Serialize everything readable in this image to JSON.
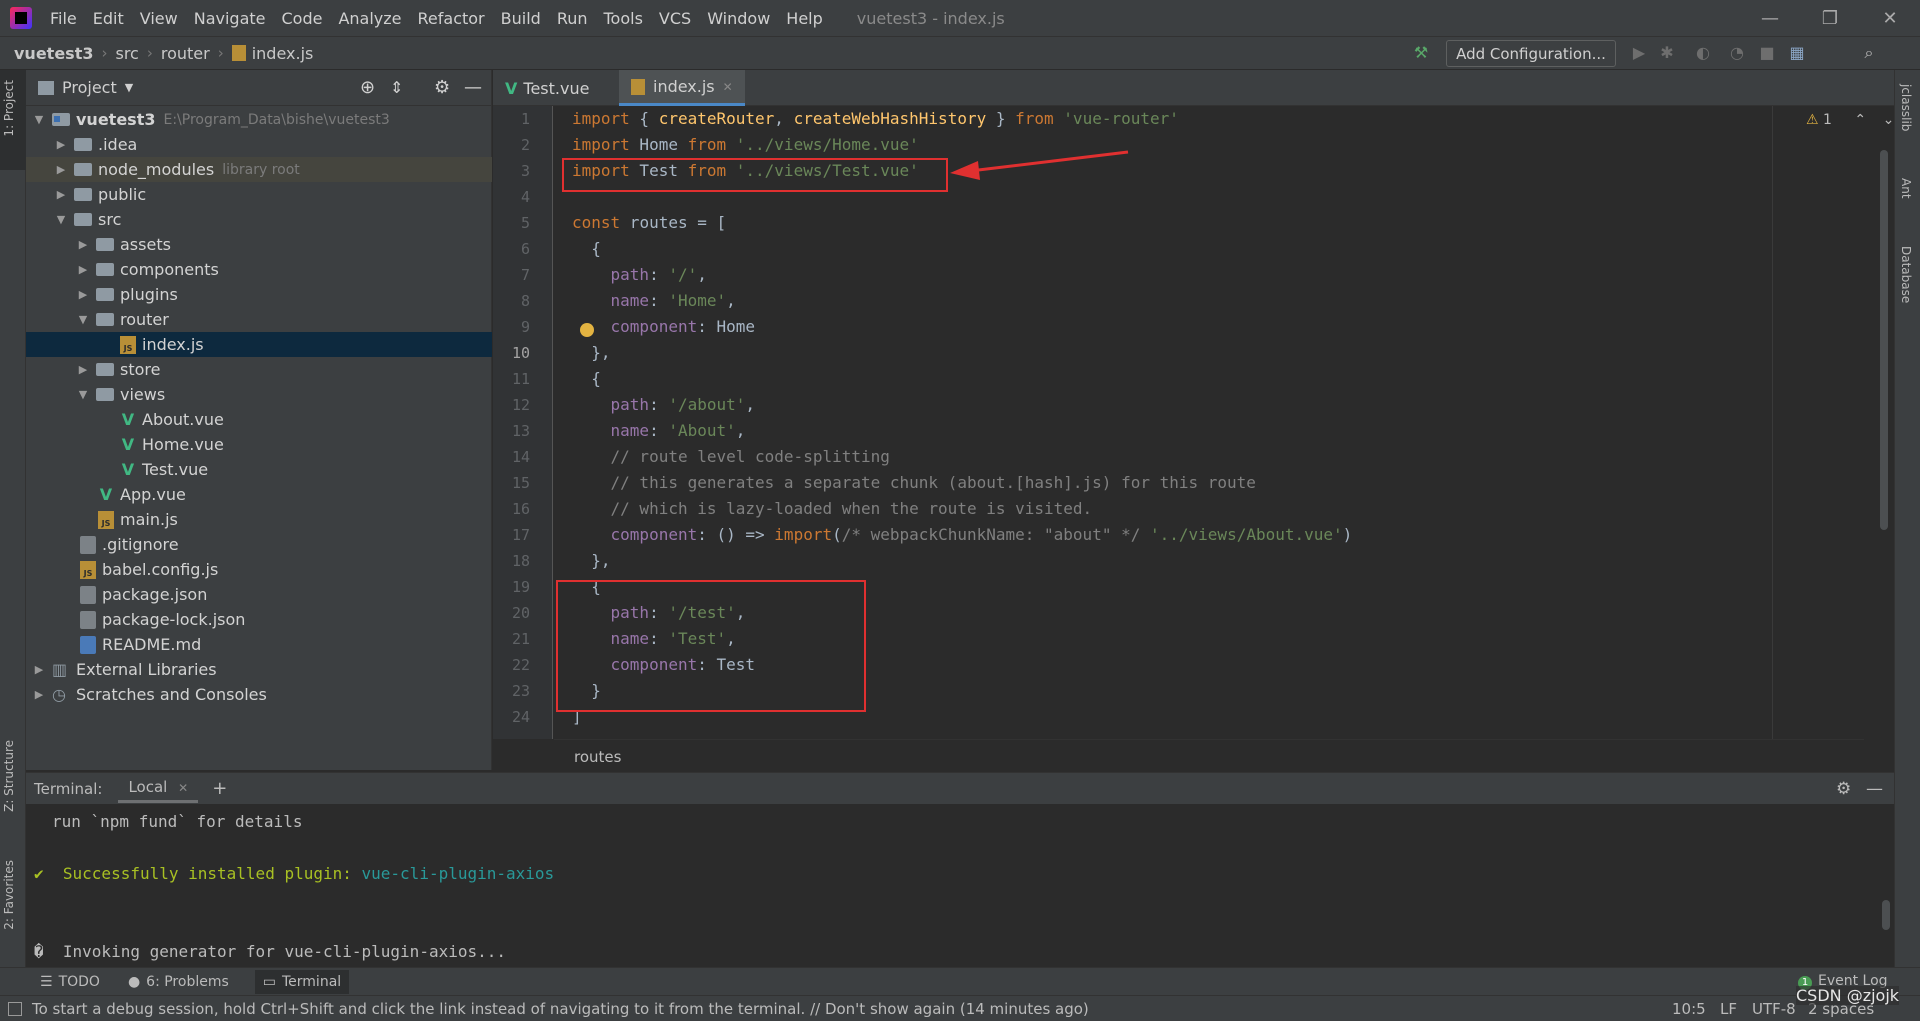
{
  "title_bar": {
    "menu": [
      "File",
      "Edit",
      "View",
      "Navigate",
      "Code",
      "Analyze",
      "Refactor",
      "Build",
      "Run",
      "Tools",
      "VCS",
      "Window",
      "Help"
    ],
    "window_title": "vuetest3 - index.js"
  },
  "nav_bar": {
    "crumbs": [
      "vuetest3",
      "src",
      "router",
      "index.js"
    ],
    "add_configuration": "Add Configuration..."
  },
  "left_stripe": {
    "project": "1: Project",
    "structure": "Z: Structure",
    "favorites": "2: Favorites"
  },
  "right_stripe": {
    "jclasslib": "jclasslib",
    "ant": "Ant",
    "database": "Database"
  },
  "project_panel": {
    "header": "Project",
    "tree": [
      {
        "label": "vuetest3",
        "extra": "E:\\Program_Data\\bishe\\vuetest3",
        "type": "project"
      },
      {
        "label": ".idea",
        "type": "folder"
      },
      {
        "label": "node_modules",
        "extra": "library root",
        "type": "folder"
      },
      {
        "label": "public",
        "type": "folder"
      },
      {
        "label": "src",
        "type": "folder"
      },
      {
        "label": "assets",
        "type": "folder"
      },
      {
        "label": "components",
        "type": "folder"
      },
      {
        "label": "plugins",
        "type": "folder"
      },
      {
        "label": "router",
        "type": "folder"
      },
      {
        "label": "index.js",
        "type": "js"
      },
      {
        "label": "store",
        "type": "folder"
      },
      {
        "label": "views",
        "type": "folder"
      },
      {
        "label": "About.vue",
        "type": "vue"
      },
      {
        "label": "Home.vue",
        "type": "vue"
      },
      {
        "label": "Test.vue",
        "type": "vue"
      },
      {
        "label": "App.vue",
        "type": "vue"
      },
      {
        "label": "main.js",
        "type": "js"
      },
      {
        "label": ".gitignore",
        "type": "cfg"
      },
      {
        "label": "babel.config.js",
        "type": "js"
      },
      {
        "label": "package.json",
        "type": "cfg"
      },
      {
        "label": "package-lock.json",
        "type": "cfg"
      },
      {
        "label": "README.md",
        "type": "md"
      },
      {
        "label": "External Libraries",
        "type": "lib"
      },
      {
        "label": "Scratches and Consoles",
        "type": "scratch"
      }
    ]
  },
  "editor": {
    "tabs": [
      "Test.vue",
      "index.js"
    ],
    "warnings": "1",
    "breadcrumb": "routes",
    "line_numbers": [
      "1",
      "2",
      "3",
      "4",
      "5",
      "6",
      "7",
      "8",
      "9",
      "10",
      "11",
      "12",
      "13",
      "14",
      "15",
      "16",
      "17",
      "18",
      "19",
      "20",
      "21",
      "22",
      "23",
      "24"
    ],
    "current_line": "10"
  },
  "terminal": {
    "title": "Terminal:",
    "tab": "Local",
    "lines": {
      "l1": "run `npm fund` for details",
      "l2_prefix": "✔  Successfully installed plugin: ",
      "l2_link": "vue-cli-plugin-axios",
      "l3": "�  Invoking generator for vue-cli-plugin-axios..."
    }
  },
  "tool_windows": {
    "todo": "TODO",
    "problems": "6: Problems",
    "terminal": "Terminal",
    "event_log": "Event Log",
    "event_count": "1"
  },
  "status_bar": {
    "message": "To start a debug session, hold Ctrl+Shift and click the link instead of navigating to it from the terminal. // Don't show again (14 minutes ago)",
    "position": "10:5",
    "line_sep": "LF",
    "encoding": "UTF-8",
    "indent": "2 spaces",
    "watermark": "CSDN @zjojk"
  },
  "colors": {
    "keyword": "#cc7832",
    "string": "#6a8759",
    "property": "#9876aa",
    "function": "#ffc66d",
    "comment": "#808080",
    "annotation_red": "#e03030"
  }
}
